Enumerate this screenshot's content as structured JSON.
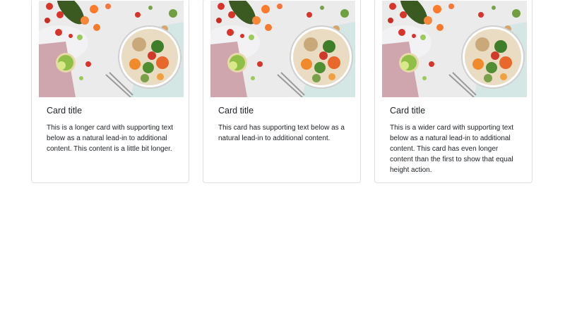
{
  "cards": [
    {
      "image_alt": "Healthy food bowl with vegetables",
      "title": "Card title",
      "text": "This is a longer card with supporting text below as a natural lead-in to additional content. This content is a little bit longer."
    },
    {
      "image_alt": "Healthy food bowl with vegetables",
      "title": "Card title",
      "text": "This card has supporting text below as a natural lead-in to additional content."
    },
    {
      "image_alt": "Healthy food bowl with vegetables",
      "title": "Card title",
      "text": "This is a wider card with supporting text below as a natural lead-in to additional content. This card has even longer content than the first to show that equal height action."
    }
  ]
}
